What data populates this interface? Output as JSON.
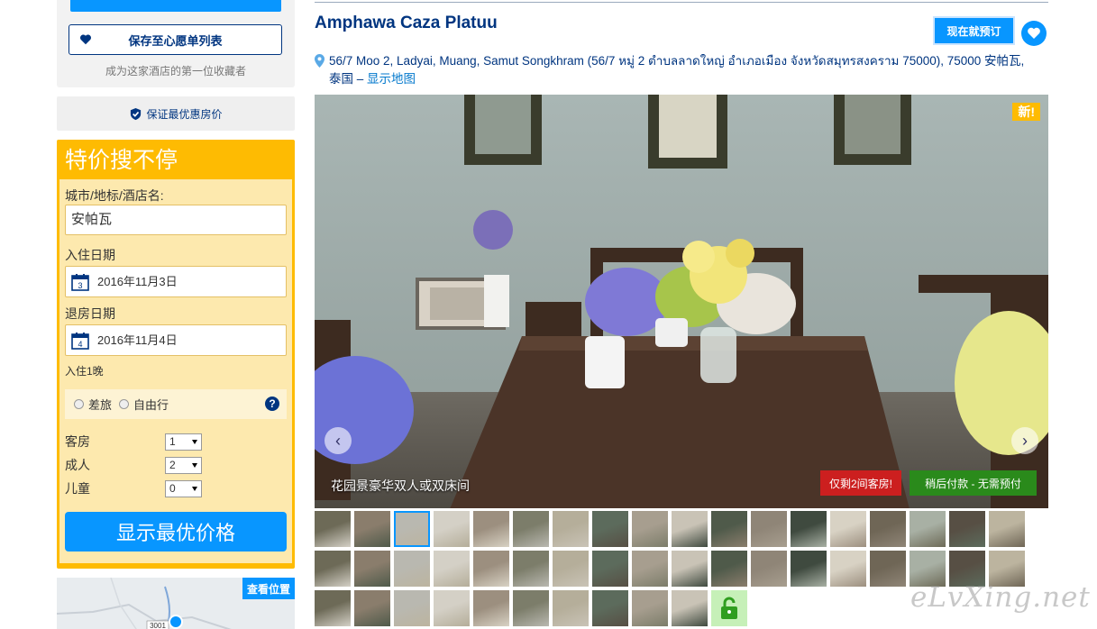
{
  "sidebar": {
    "wishlist_button": "保存至心愿单列表",
    "wishlist_sub": "成为这家酒店的第一位收藏者",
    "guarantee": "保证最优惠房价",
    "search": {
      "title": "特价搜不停",
      "destination_label": "城市/地标/酒店名:",
      "destination_value": "安帕瓦",
      "checkin_label": "入住日期",
      "checkin_value": "2016年11月3日",
      "checkin_day": "3",
      "checkout_label": "退房日期",
      "checkout_value": "2016年11月4日",
      "checkout_day": "4",
      "nights": "入住1晚",
      "trip_business": "差旅",
      "trip_leisure": "自由行",
      "help": "?",
      "rooms_label": "客房",
      "rooms_value": "1",
      "adults_label": "成人",
      "adults_value": "2",
      "children_label": "儿童",
      "children_value": "0",
      "submit": "显示最优价格"
    },
    "map_button": "查看位置",
    "map_road_number": "3001"
  },
  "hotel": {
    "name": "Amphawa Caza Platuu",
    "book_button": "现在就预订",
    "address": "56/7 Moo 2, Ladyai, Muang, Samut Songkhram (56/7 หมู่ 2 ตำบลลาดใหญ่ อำเภอเมือง จังหวัดสมุทรสงคราม 75000), 75000 安帕瓦, 泰国",
    "address_sep": " – ",
    "map_link": "显示地图"
  },
  "photo": {
    "new_badge": "新!",
    "caption": "花园景豪华双人或双床间",
    "rooms_left": "仅剩2间客房!",
    "pay_later": "稍后付款 - 无需预付",
    "prev": "‹",
    "next": "›"
  },
  "watermark": "eLvXing.net",
  "colors": {
    "brand_blue": "#003580",
    "button_blue": "#0896ff",
    "search_yellow": "#febb02",
    "alert_red": "#cc1f1f",
    "success_green": "#2a8a1b"
  }
}
